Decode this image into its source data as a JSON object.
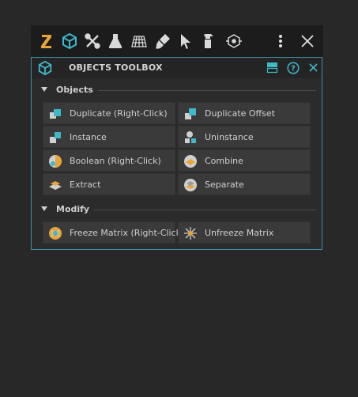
{
  "toolbar": {
    "items": [
      {
        "icon": "zbrush-z-icon"
      },
      {
        "icon": "cube-icon"
      },
      {
        "icon": "tools-icon"
      },
      {
        "icon": "flask-icon"
      },
      {
        "icon": "grid-icon"
      },
      {
        "icon": "paint-brush-icon"
      },
      {
        "icon": "cursor-icon"
      },
      {
        "icon": "spray-icon"
      },
      {
        "icon": "node-hexagon-icon"
      },
      {
        "icon": "more-vertical-icon"
      },
      {
        "icon": "close-icon"
      }
    ]
  },
  "panel": {
    "title": "OBJECTS TOOLBOX",
    "accent_color": "#3fb8c9",
    "sections": {
      "objects": {
        "label": "Objects",
        "buttons": [
          {
            "label": "Duplicate (Right-Click)",
            "icon": "duplicate-icon"
          },
          {
            "label": "Duplicate Offset",
            "icon": "duplicate-offset-icon"
          },
          {
            "label": "Instance",
            "icon": "instance-icon"
          },
          {
            "label": "Uninstance",
            "icon": "uninstance-icon"
          },
          {
            "label": "Boolean (Right-Click)",
            "icon": "boolean-icon"
          },
          {
            "label": "Combine",
            "icon": "combine-icon"
          },
          {
            "label": "Extract",
            "icon": "extract-icon"
          },
          {
            "label": "Separate",
            "icon": "separate-icon"
          }
        ]
      },
      "modify": {
        "label": "Modify",
        "buttons": [
          {
            "label": "Freeze Matrix (Right-Click)",
            "icon": "freeze-matrix-icon"
          },
          {
            "label": "Unfreeze Matrix",
            "icon": "unfreeze-matrix-icon"
          }
        ]
      }
    }
  }
}
